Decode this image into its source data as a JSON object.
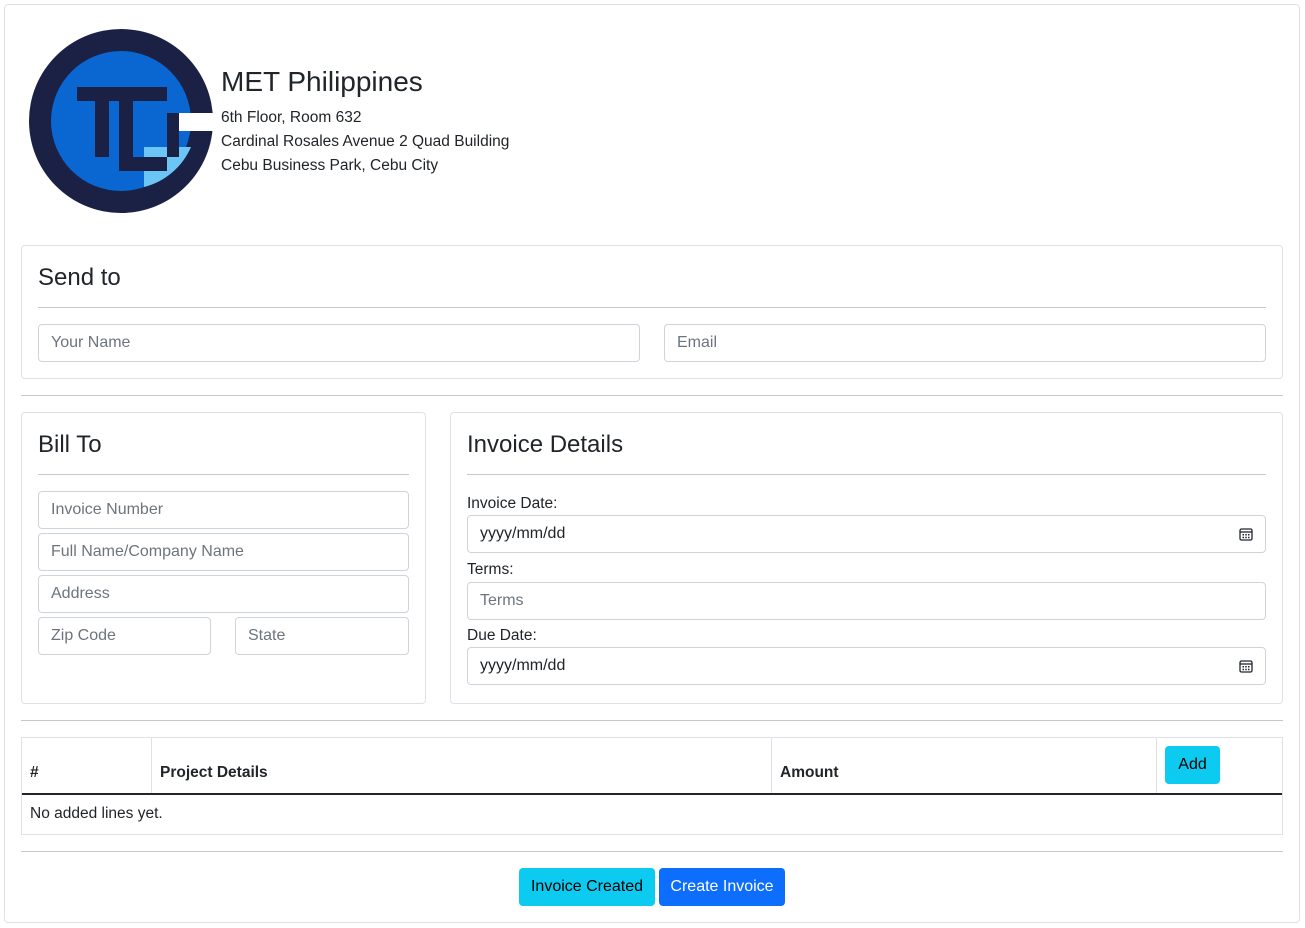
{
  "company": {
    "name": "MET Philippines",
    "address_line1": "6th Floor, Room 632",
    "address_line2": "Cardinal Rosales Avenue 2 Quad Building",
    "address_line3": "Cebu Business Park, Cebu City",
    "logo_colors": {
      "ring": "#1b2145",
      "blue": "#0a66d0",
      "light": "#6cc6f5"
    }
  },
  "send_to": {
    "title": "Send to",
    "name_placeholder": "Your Name",
    "email_placeholder": "Email"
  },
  "bill_to": {
    "title": "Bill To",
    "invoice_number_placeholder": "Invoice Number",
    "name_placeholder": "Full Name/Company Name",
    "address_placeholder": "Address",
    "zip_placeholder": "Zip Code",
    "state_placeholder": "State"
  },
  "invoice_details": {
    "title": "Invoice Details",
    "invoice_date_label": "Invoice Date:",
    "invoice_date_value": "yyyy/mm/dd",
    "terms_label": "Terms:",
    "terms_placeholder": "Terms",
    "due_date_label": "Due Date:",
    "due_date_value": "yyyy/mm/dd"
  },
  "table": {
    "columns": [
      "#",
      "Project Details",
      "Amount"
    ],
    "add_label": "Add",
    "empty_text": "No added lines yet."
  },
  "actions": {
    "invoice_created_label": "Invoice Created",
    "create_invoice_label": "Create Invoice"
  },
  "colors": {
    "info": "#0dcaf0",
    "primary": "#0d6efd",
    "border": "#dee2e6"
  }
}
